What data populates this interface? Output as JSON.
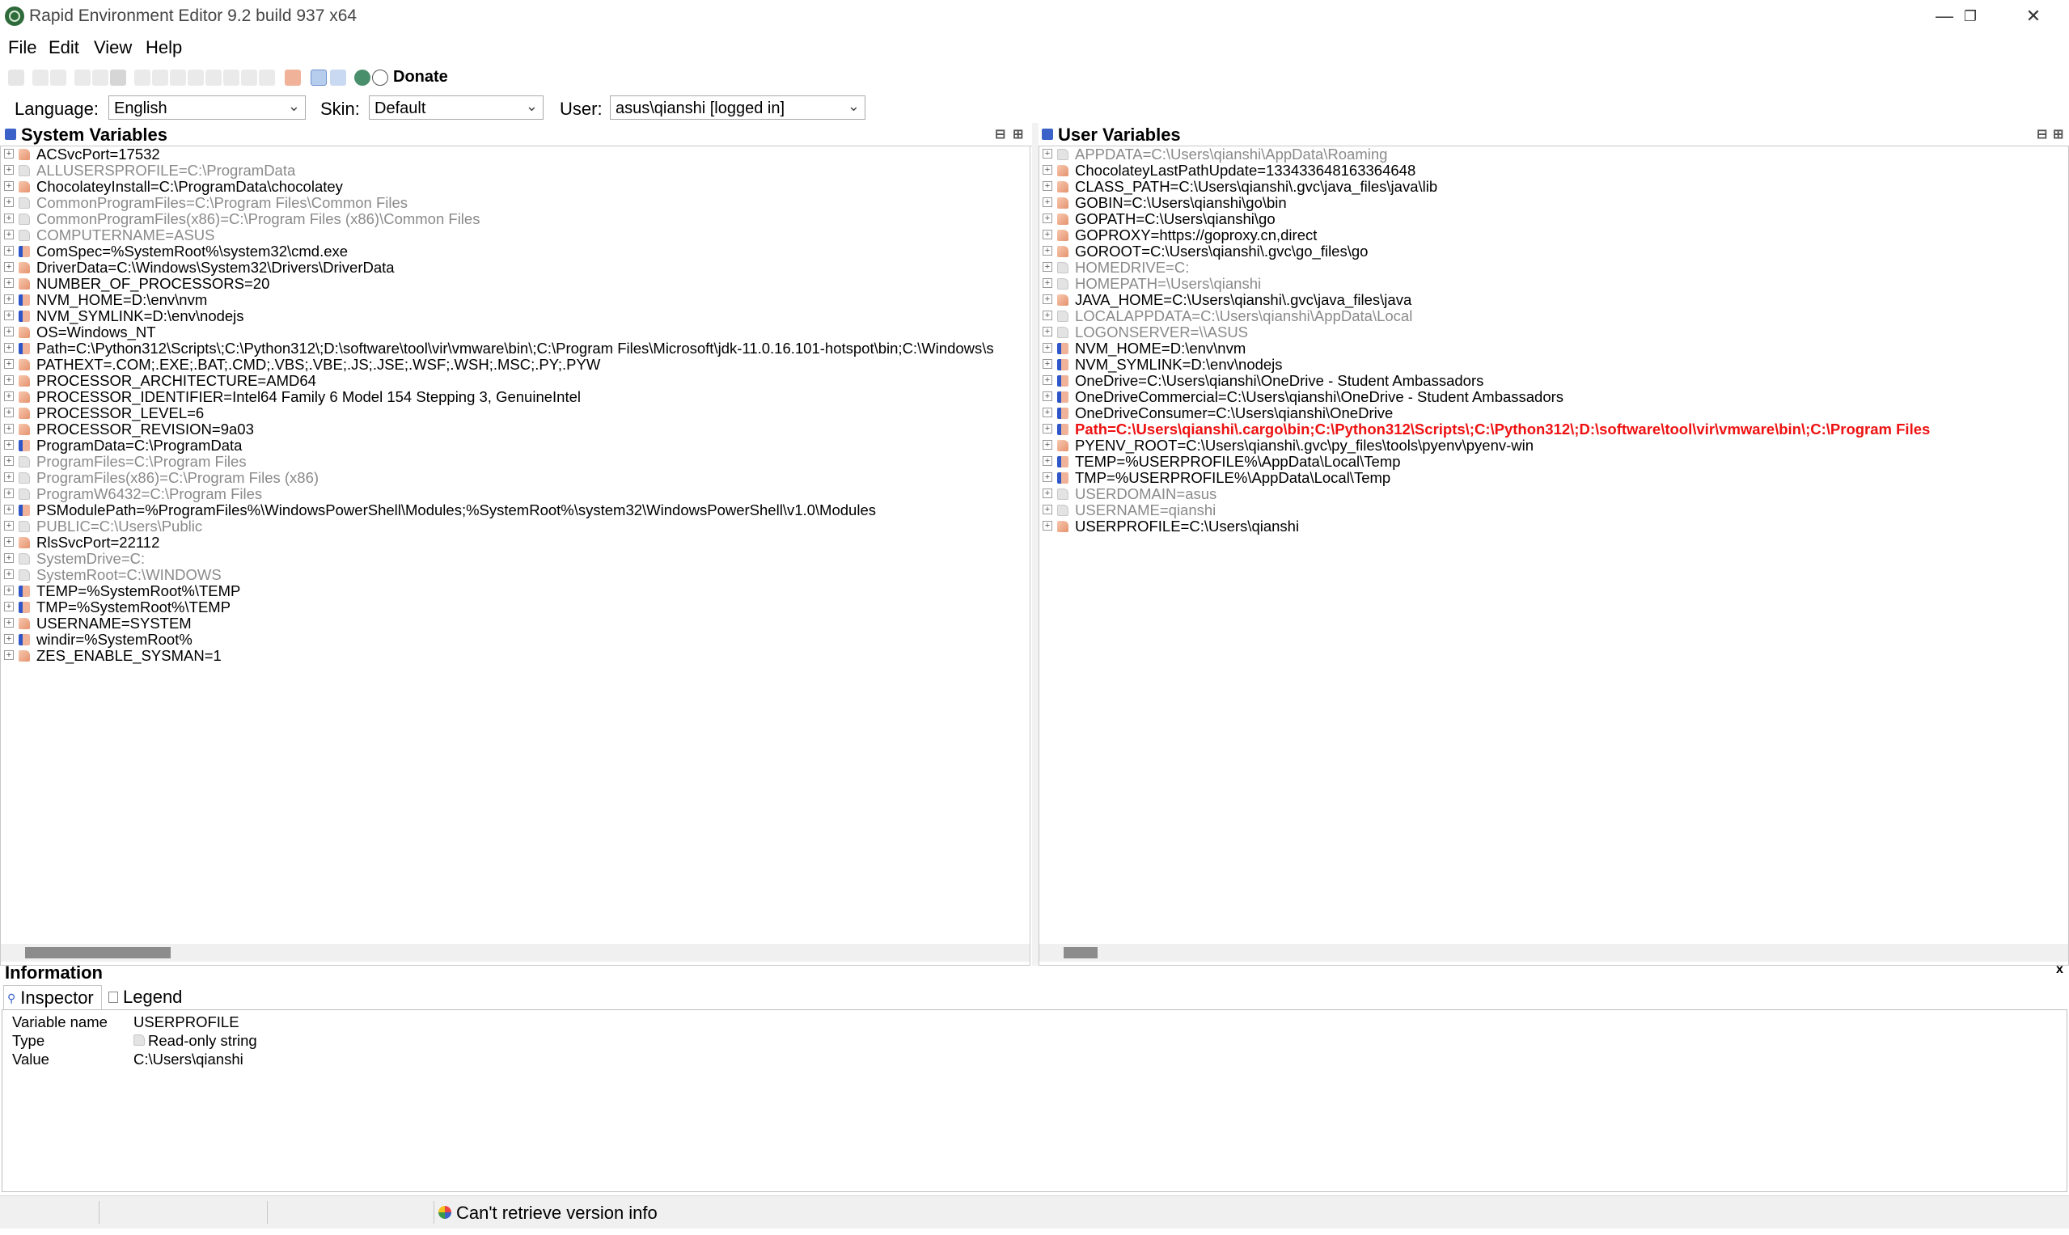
{
  "window": {
    "title": "Rapid Environment Editor 9.2 build 937 x64",
    "controls": {
      "minimize": "—",
      "restore": "❐",
      "close": "✕"
    }
  },
  "menu": [
    "File",
    "Edit",
    "View",
    "Help"
  ],
  "toolbar": {
    "donate_label": "Donate"
  },
  "selectors": {
    "language_label": "Language:",
    "language_value": "English",
    "skin_label": "Skin:",
    "skin_value": "Default",
    "user_label": "User:",
    "user_value": "asus\\qianshi [logged in]"
  },
  "system_panel": {
    "title": "System Variables",
    "rows": [
      {
        "text": "ACSvcPort=17532",
        "kind": "normal",
        "icon": "tag"
      },
      {
        "text": "ALLUSERSPROFILE=C:\\ProgramData",
        "kind": "ro",
        "icon": "tagro"
      },
      {
        "text": "ChocolateyInstall=C:\\ProgramData\\chocolatey",
        "kind": "normal",
        "icon": "tag"
      },
      {
        "text": "CommonProgramFiles=C:\\Program Files\\Common Files",
        "kind": "ro",
        "icon": "tagro"
      },
      {
        "text": "CommonProgramFiles(x86)=C:\\Program Files (x86)\\Common Files",
        "kind": "ro",
        "icon": "tagro"
      },
      {
        "text": "COMPUTERNAME=ASUS",
        "kind": "ro",
        "icon": "tagro"
      },
      {
        "text": "ComSpec=%SystemRoot%\\system32\\cmd.exe",
        "kind": "normal",
        "icon": "list"
      },
      {
        "text": "DriverData=C:\\Windows\\System32\\Drivers\\DriverData",
        "kind": "normal",
        "icon": "tag"
      },
      {
        "text": "NUMBER_OF_PROCESSORS=20",
        "kind": "normal",
        "icon": "tag"
      },
      {
        "text": "NVM_HOME=D:\\env\\nvm",
        "kind": "normal",
        "icon": "list"
      },
      {
        "text": "NVM_SYMLINK=D:\\env\\nodejs",
        "kind": "normal",
        "icon": "list"
      },
      {
        "text": "OS=Windows_NT",
        "kind": "normal",
        "icon": "tag"
      },
      {
        "text": "Path=C:\\Python312\\Scripts\\;C:\\Python312\\;D:\\software\\tool\\vir\\vmware\\bin\\;C:\\Program Files\\Microsoft\\jdk-11.0.16.101-hotspot\\bin;C:\\Windows\\s",
        "kind": "normal",
        "icon": "list"
      },
      {
        "text": "PATHEXT=.COM;.EXE;.BAT;.CMD;.VBS;.VBE;.JS;.JSE;.WSF;.WSH;.MSC;.PY;.PYW",
        "kind": "normal",
        "icon": "tag"
      },
      {
        "text": "PROCESSOR_ARCHITECTURE=AMD64",
        "kind": "normal",
        "icon": "tag"
      },
      {
        "text": "PROCESSOR_IDENTIFIER=Intel64 Family 6 Model 154 Stepping 3, GenuineIntel",
        "kind": "normal",
        "icon": "tag"
      },
      {
        "text": "PROCESSOR_LEVEL=6",
        "kind": "normal",
        "icon": "tag"
      },
      {
        "text": "PROCESSOR_REVISION=9a03",
        "kind": "normal",
        "icon": "tag"
      },
      {
        "text": "ProgramData=C:\\ProgramData",
        "kind": "normal",
        "icon": "list"
      },
      {
        "text": "ProgramFiles=C:\\Program Files",
        "kind": "ro",
        "icon": "tagro"
      },
      {
        "text": "ProgramFiles(x86)=C:\\Program Files (x86)",
        "kind": "ro",
        "icon": "tagro"
      },
      {
        "text": "ProgramW6432=C:\\Program Files",
        "kind": "ro",
        "icon": "tagro"
      },
      {
        "text": "PSModulePath=%ProgramFiles%\\WindowsPowerShell\\Modules;%SystemRoot%\\system32\\WindowsPowerShell\\v1.0\\Modules",
        "kind": "normal",
        "icon": "list"
      },
      {
        "text": "PUBLIC=C:\\Users\\Public",
        "kind": "ro",
        "icon": "tagro"
      },
      {
        "text": "RlsSvcPort=22112",
        "kind": "normal",
        "icon": "tag"
      },
      {
        "text": "SystemDrive=C:",
        "kind": "ro",
        "icon": "tagro"
      },
      {
        "text": "SystemRoot=C:\\WINDOWS",
        "kind": "ro",
        "icon": "tagro"
      },
      {
        "text": "TEMP=%SystemRoot%\\TEMP",
        "kind": "normal",
        "icon": "list"
      },
      {
        "text": "TMP=%SystemRoot%\\TEMP",
        "kind": "normal",
        "icon": "list"
      },
      {
        "text": "USERNAME=SYSTEM",
        "kind": "normal",
        "icon": "tag"
      },
      {
        "text": "windir=%SystemRoot%",
        "kind": "normal",
        "icon": "list"
      },
      {
        "text": "ZES_ENABLE_SYSMAN=1",
        "kind": "normal",
        "icon": "tag"
      }
    ]
  },
  "user_panel": {
    "title": "User Variables",
    "rows": [
      {
        "text": "APPDATA=C:\\Users\\qianshi\\AppData\\Roaming",
        "kind": "ro",
        "icon": "tagro"
      },
      {
        "text": "ChocolateyLastPathUpdate=133433648163364648",
        "kind": "normal",
        "icon": "tag"
      },
      {
        "text": "CLASS_PATH=C:\\Users\\qianshi\\.gvc\\java_files\\java\\lib",
        "kind": "normal",
        "icon": "tag"
      },
      {
        "text": "GOBIN=C:\\Users\\qianshi\\go\\bin",
        "kind": "normal",
        "icon": "tag"
      },
      {
        "text": "GOPATH=C:\\Users\\qianshi\\go",
        "kind": "normal",
        "icon": "tag"
      },
      {
        "text": "GOPROXY=https://goproxy.cn,direct",
        "kind": "normal",
        "icon": "tag"
      },
      {
        "text": "GOROOT=C:\\Users\\qianshi\\.gvc\\go_files\\go",
        "kind": "normal",
        "icon": "tag"
      },
      {
        "text": "HOMEDRIVE=C:",
        "kind": "ro",
        "icon": "tagro"
      },
      {
        "text": "HOMEPATH=\\Users\\qianshi",
        "kind": "ro",
        "icon": "tagro"
      },
      {
        "text": "JAVA_HOME=C:\\Users\\qianshi\\.gvc\\java_files\\java",
        "kind": "normal",
        "icon": "tag"
      },
      {
        "text": "LOCALAPPDATA=C:\\Users\\qianshi\\AppData\\Local",
        "kind": "ro",
        "icon": "tagro"
      },
      {
        "text": "LOGONSERVER=\\\\ASUS",
        "kind": "ro",
        "icon": "tagro"
      },
      {
        "text": "NVM_HOME=D:\\env\\nvm",
        "kind": "normal",
        "icon": "list"
      },
      {
        "text": "NVM_SYMLINK=D:\\env\\nodejs",
        "kind": "normal",
        "icon": "list"
      },
      {
        "text": "OneDrive=C:\\Users\\qianshi\\OneDrive - Student Ambassadors",
        "kind": "normal",
        "icon": "list"
      },
      {
        "text": "OneDriveCommercial=C:\\Users\\qianshi\\OneDrive - Student Ambassadors",
        "kind": "normal",
        "icon": "list"
      },
      {
        "text": "OneDriveConsumer=C:\\Users\\qianshi\\OneDrive",
        "kind": "normal",
        "icon": "list"
      },
      {
        "text": "Path=C:\\Users\\qianshi\\.cargo\\bin;C:\\Python312\\Scripts\\;C:\\Python312\\;D:\\software\\tool\\vir\\vmware\\bin\\;C:\\Program Files",
        "kind": "hl",
        "icon": "list"
      },
      {
        "text": "PYENV_ROOT=C:\\Users\\qianshi\\.gvc\\py_files\\tools\\pyenv\\pyenv-win",
        "kind": "normal",
        "icon": "tag"
      },
      {
        "text": "TEMP=%USERPROFILE%\\AppData\\Local\\Temp",
        "kind": "normal",
        "icon": "list"
      },
      {
        "text": "TMP=%USERPROFILE%\\AppData\\Local\\Temp",
        "kind": "normal",
        "icon": "list"
      },
      {
        "text": "USERDOMAIN=asus",
        "kind": "ro",
        "icon": "tagro"
      },
      {
        "text": "USERNAME=qianshi",
        "kind": "ro",
        "icon": "tagro"
      },
      {
        "text": "USERPROFILE=C:\\Users\\qianshi",
        "kind": "normal",
        "icon": "tag"
      }
    ]
  },
  "info": {
    "title": "Information",
    "close": "x",
    "tabs": [
      "Inspector",
      "Legend"
    ],
    "fields": [
      {
        "label": "Variable name",
        "value": "USERPROFILE"
      },
      {
        "label": "Type",
        "value": "Read-only string"
      },
      {
        "label": "Value",
        "value": "C:\\Users\\qianshi"
      }
    ]
  },
  "status": {
    "text": "Can't retrieve version info"
  },
  "colors": {
    "highlight": "#e11111",
    "readonly": "#8a8a8a",
    "accent": "#2e56c8"
  },
  "icons": {
    "expand": "plus-box-icon",
    "normal": "tag-icon",
    "readonly": "readonly-tag-icon",
    "list": "list-variable-icon"
  }
}
